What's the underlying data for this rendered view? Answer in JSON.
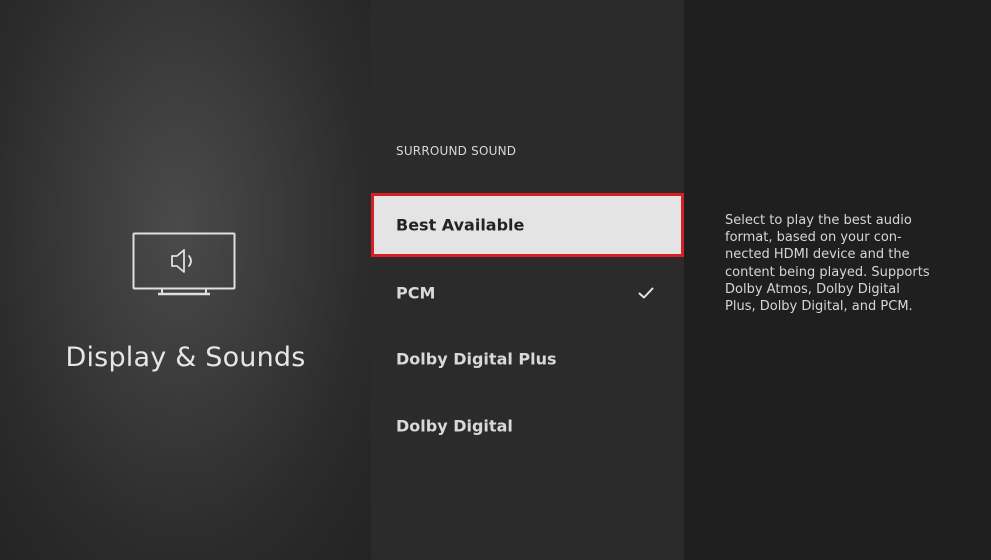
{
  "category": {
    "icon": "tv-speaker-icon",
    "title": "Display & Sounds"
  },
  "menu": {
    "header": "SURROUND SOUND",
    "options": [
      {
        "label": "Best Available",
        "focused": true,
        "selected": false
      },
      {
        "label": "PCM",
        "focused": false,
        "selected": true
      },
      {
        "label": "Dolby Digital Plus",
        "focused": false,
        "selected": false
      },
      {
        "label": "Dolby Digital",
        "focused": false,
        "selected": false
      }
    ]
  },
  "description": {
    "text": "Select to play the best audio\nformat, based on your con-\nnected HDMI device and the\ncontent being played. Supports\nDolby Atmos, Dolby Digital\nPlus, Dolby Digital, and PCM."
  },
  "colors": {
    "focus_border": "#d61f26",
    "focus_background": "#e4e4e4"
  }
}
